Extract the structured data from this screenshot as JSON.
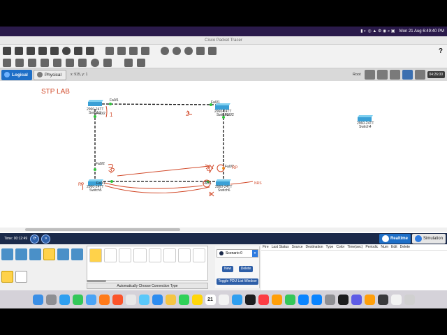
{
  "menubar": {
    "datetime": "Mon 21 Aug  6:49:40 PM"
  },
  "window": {
    "title": "Cisco Packet Tracer"
  },
  "toolbar": {
    "file_icons": [
      "new-icon",
      "open-icon",
      "save-icon",
      "save-as-icon",
      "print-icon",
      "info-icon",
      "network-icon",
      "custom-device-icon"
    ],
    "edit_icons": [
      "copy-icon",
      "paste-icon",
      "undo-icon",
      "redo-icon"
    ],
    "view_icons": [
      "zoom-in-icon",
      "zoom-reset-icon",
      "zoom-out-icon",
      "palette-icon",
      "custom-device-dialog-icon"
    ],
    "help_label": "?"
  },
  "toolbar2": {
    "icons": [
      "select-icon",
      "inspect-icon",
      "delete-icon",
      "resize-icon",
      "place-note-icon",
      "draw-line-icon",
      "draw-rectangle-icon",
      "draw-ellipse-icon",
      "draw-freeform-icon",
      "simple-pdu-icon",
      "complex-pdu-icon"
    ]
  },
  "viewbar": {
    "logical_label": "Logical",
    "physical_label": "Physical",
    "coords": "x: 915, y: 1",
    "root_label": "Root",
    "clock": "04:26:00"
  },
  "workspace": {
    "note": "STP LAB",
    "devices": [
      {
        "id": "switch1",
        "model": "2960-24TT",
        "name": "Switch1",
        "ports": [
          "Fa0/1",
          "Fa0/2"
        ]
      },
      {
        "id": "switch2",
        "model": "2960-24TT",
        "name": "Switch2",
        "ports": [
          "Fa0/1",
          "Fa0/2"
        ]
      },
      {
        "id": "switch4",
        "model": "2960-24TT",
        "name": "Switch4"
      },
      {
        "id": "switch5",
        "model": "2960-24TT",
        "name": "Switch5",
        "ports": [
          "Fa0/2",
          "Fa0/1"
        ]
      },
      {
        "id": "switch6",
        "model": "2960-24TT",
        "name": "Switch6",
        "ports": [
          "Fa0/2",
          "Fa0/1"
        ]
      }
    ],
    "annotations": [
      "1",
      "2",
      "3",
      "4",
      "RP",
      "NRS",
      "x",
      "RP"
    ]
  },
  "timebar": {
    "time": "Time: 00:12:49",
    "realtime_label": "Realtime",
    "simulation_label": "Simulation"
  },
  "bottom": {
    "connection_caption": "Automatically Choose Connection Type",
    "scenario_label": "Scenario 0",
    "new_label": "New",
    "delete_label": "Delete",
    "toggle_label": "Toggle PDU List Window",
    "pdu_columns": [
      "Fire",
      "Last Status",
      "Source",
      "Destination",
      "Type",
      "Color",
      "Time(sec)",
      "Periodic",
      "Num",
      "Edit",
      "Delete"
    ]
  },
  "dock": {
    "apps": [
      "finder-icon",
      "launchpad-icon",
      "safari-icon",
      "messages-icon",
      "mail-icon",
      "firefox-icon",
      "brave-icon",
      "chrome-icon",
      "photos-icon",
      "facetime-icon",
      "zoom-icon",
      "notes-icon",
      "calendar-icon",
      "reminders-icon",
      "appletv-icon",
      "music-icon",
      "numbers-icon",
      "keynote-icon",
      "appstore-icon",
      "settings-icon",
      "packet-tracer-icon",
      "preview-icon",
      "terminal-icon",
      "trash-icon"
    ],
    "calendar_day": "21"
  },
  "colors": {
    "accent": "#1e6fc7",
    "link": "#111111",
    "annotation": "#d24a2a",
    "menubar": "#2a1a4a"
  }
}
